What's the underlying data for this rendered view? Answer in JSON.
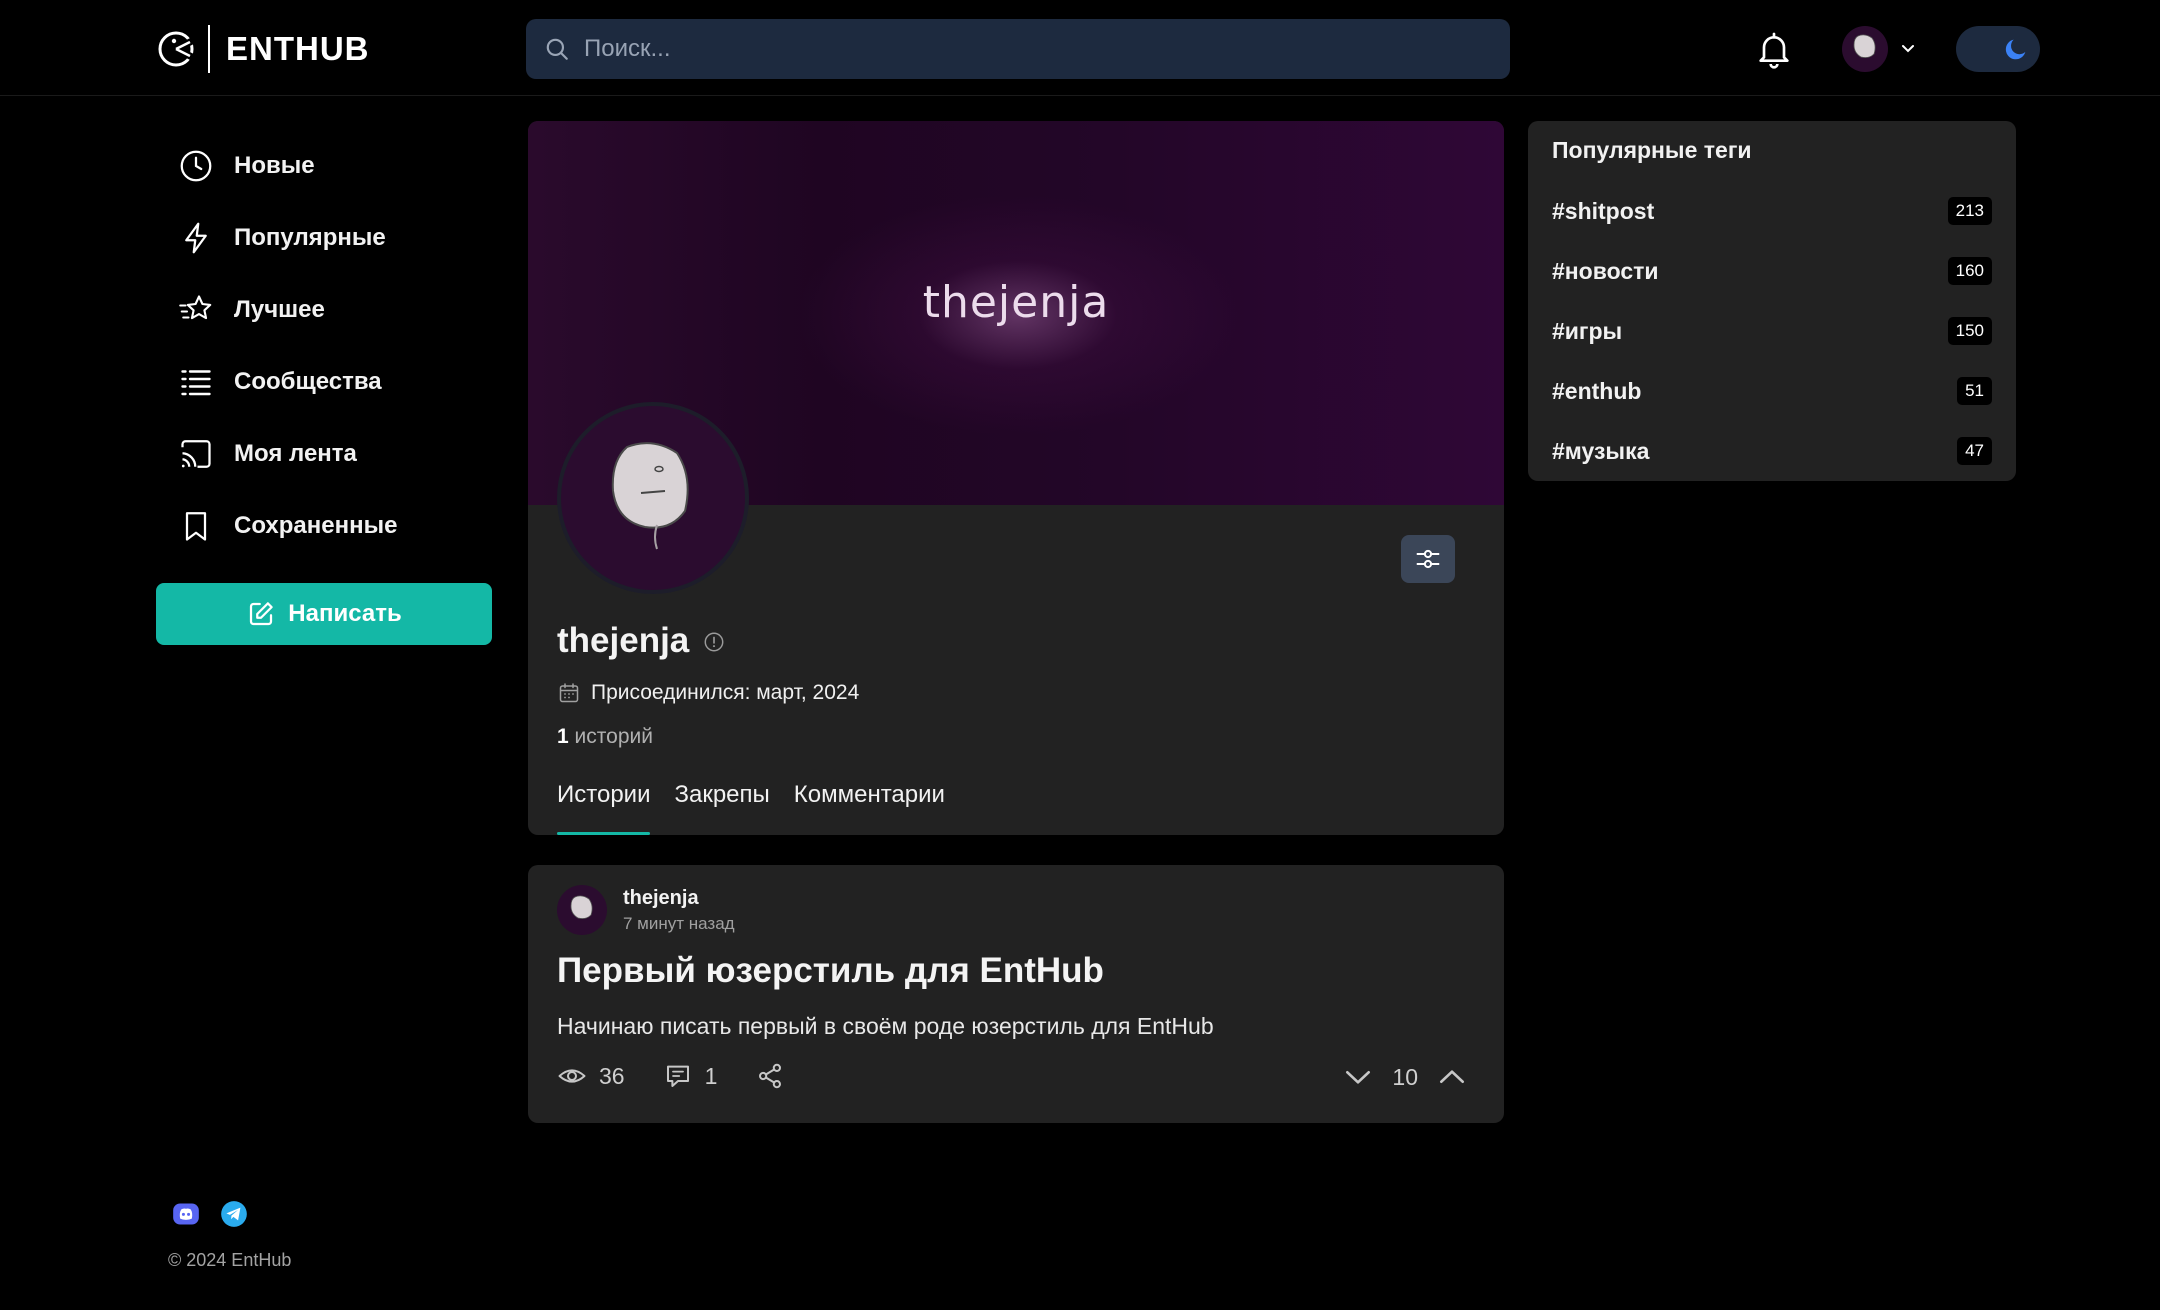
{
  "header": {
    "brand": "ENTHUB",
    "search_placeholder": "Поиск..."
  },
  "nav": {
    "items": [
      {
        "label": "Новые",
        "icon": "clock-icon"
      },
      {
        "label": "Популярные",
        "icon": "lightning-icon"
      },
      {
        "label": "Лучшее",
        "icon": "star-icon"
      },
      {
        "label": "Сообщества",
        "icon": "list-icon"
      },
      {
        "label": "Моя лента",
        "icon": "cast-icon"
      },
      {
        "label": "Сохраненные",
        "icon": "bookmark-icon"
      }
    ],
    "write_label": "Написать"
  },
  "profile": {
    "banner_text": "thejenja",
    "username": "thejenja",
    "joined": "Присоединился: март, 2024",
    "stories_count": "1",
    "stories_label": "историй",
    "tabs": [
      "Истории",
      "Закрепы",
      "Комментарии"
    ],
    "active_tab": "Истории"
  },
  "post": {
    "author": "thejenja",
    "time": "7 минут назад",
    "title": "Первый юзерстиль для EntHub",
    "excerpt": "Начинаю писать первый в своём роде юзерстиль для EntHub",
    "views": "36",
    "comments": "1",
    "rating": "10"
  },
  "tags": {
    "title": "Популярные теги",
    "items": [
      {
        "name": "#shitpost",
        "count": "213"
      },
      {
        "name": "#новости",
        "count": "160"
      },
      {
        "name": "#игры",
        "count": "150"
      },
      {
        "name": "#enthub",
        "count": "51"
      },
      {
        "name": "#музыка",
        "count": "47"
      }
    ]
  },
  "footer": {
    "copyright": "© 2024 EntHub",
    "socials": [
      "discord-icon",
      "telegram-icon"
    ]
  },
  "colors": {
    "accent": "#14b8a6",
    "card": "#222222",
    "background": "#000000",
    "search_bg": "#1d2a3f",
    "theme_moon": "#3b82f6",
    "discord": "#5865f2",
    "telegram": "#2aabee"
  }
}
